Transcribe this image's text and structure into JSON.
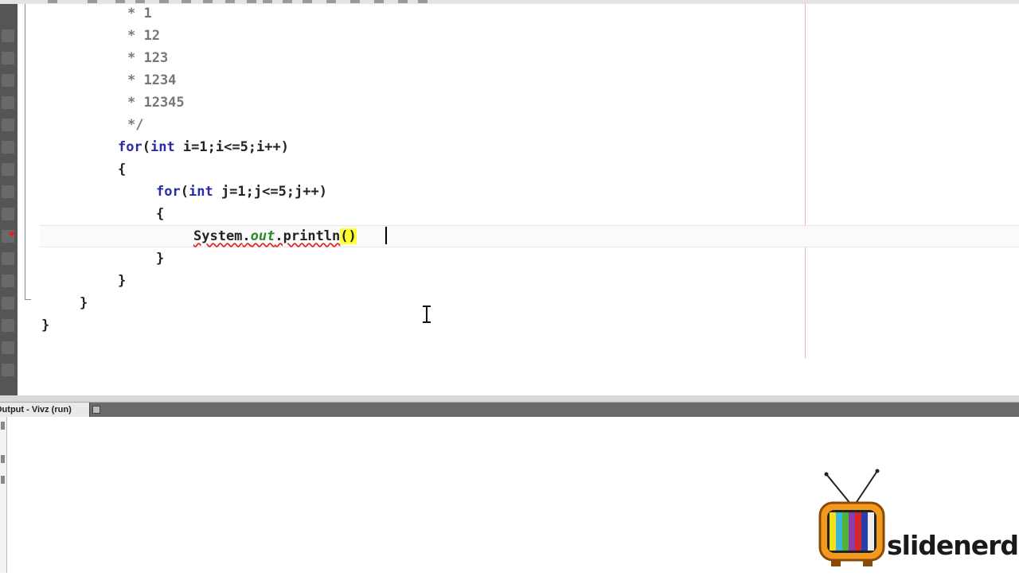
{
  "editor": {
    "lines": [
      {
        "parts": [
          {
            "t": "* 1",
            "c": "comment"
          }
        ]
      },
      {
        "parts": [
          {
            "t": "* 12",
            "c": "comment"
          }
        ]
      },
      {
        "parts": [
          {
            "t": "* 123",
            "c": "comment"
          }
        ]
      },
      {
        "parts": [
          {
            "t": "* 1234",
            "c": "comment"
          }
        ]
      },
      {
        "parts": [
          {
            "t": "* 12345",
            "c": "comment"
          }
        ]
      },
      {
        "parts": [
          {
            "t": "*/",
            "c": "comment"
          }
        ]
      },
      {
        "parts": [
          {
            "t": "for",
            "c": "kw"
          },
          {
            "t": "(",
            "c": ""
          },
          {
            "t": "int",
            "c": "kw"
          },
          {
            "t": " i=1;i<=5;i++)",
            "c": ""
          }
        ]
      },
      {
        "parts": [
          {
            "t": "{",
            "c": ""
          }
        ]
      },
      {
        "parts": [
          {
            "t": "for",
            "c": "kw"
          },
          {
            "t": "(",
            "c": ""
          },
          {
            "t": "int",
            "c": "kw"
          },
          {
            "t": " j=1;j<=5;j++)",
            "c": ""
          }
        ]
      },
      {
        "parts": [
          {
            "t": "{",
            "c": ""
          }
        ]
      },
      {
        "parts": [
          {
            "t": "System",
            "c": "err"
          },
          {
            "t": ".",
            "c": "err"
          },
          {
            "t": "out",
            "c": "field err"
          },
          {
            "t": ".println",
            "c": "err"
          },
          {
            "t": "()",
            "c": "paren-hl"
          }
        ]
      },
      {
        "parts": [
          {
            "t": "}",
            "c": ""
          }
        ]
      },
      {
        "parts": [
          {
            "t": "}",
            "c": ""
          }
        ]
      },
      {
        "parts": [
          {
            "t": "}",
            "c": ""
          }
        ]
      },
      {
        "parts": [
          {
            "t": "}",
            "c": ""
          }
        ]
      }
    ]
  },
  "output_panel": {
    "tab_label": "Output - Vivz (run)"
  },
  "logo": {
    "text": "slidenerd"
  },
  "colors": {
    "keyword": "#2b2ba8",
    "comment": "#777777",
    "field": "#2a8a2a",
    "error_underline": "#dd2222",
    "bracket_highlight": "#ffff33"
  }
}
